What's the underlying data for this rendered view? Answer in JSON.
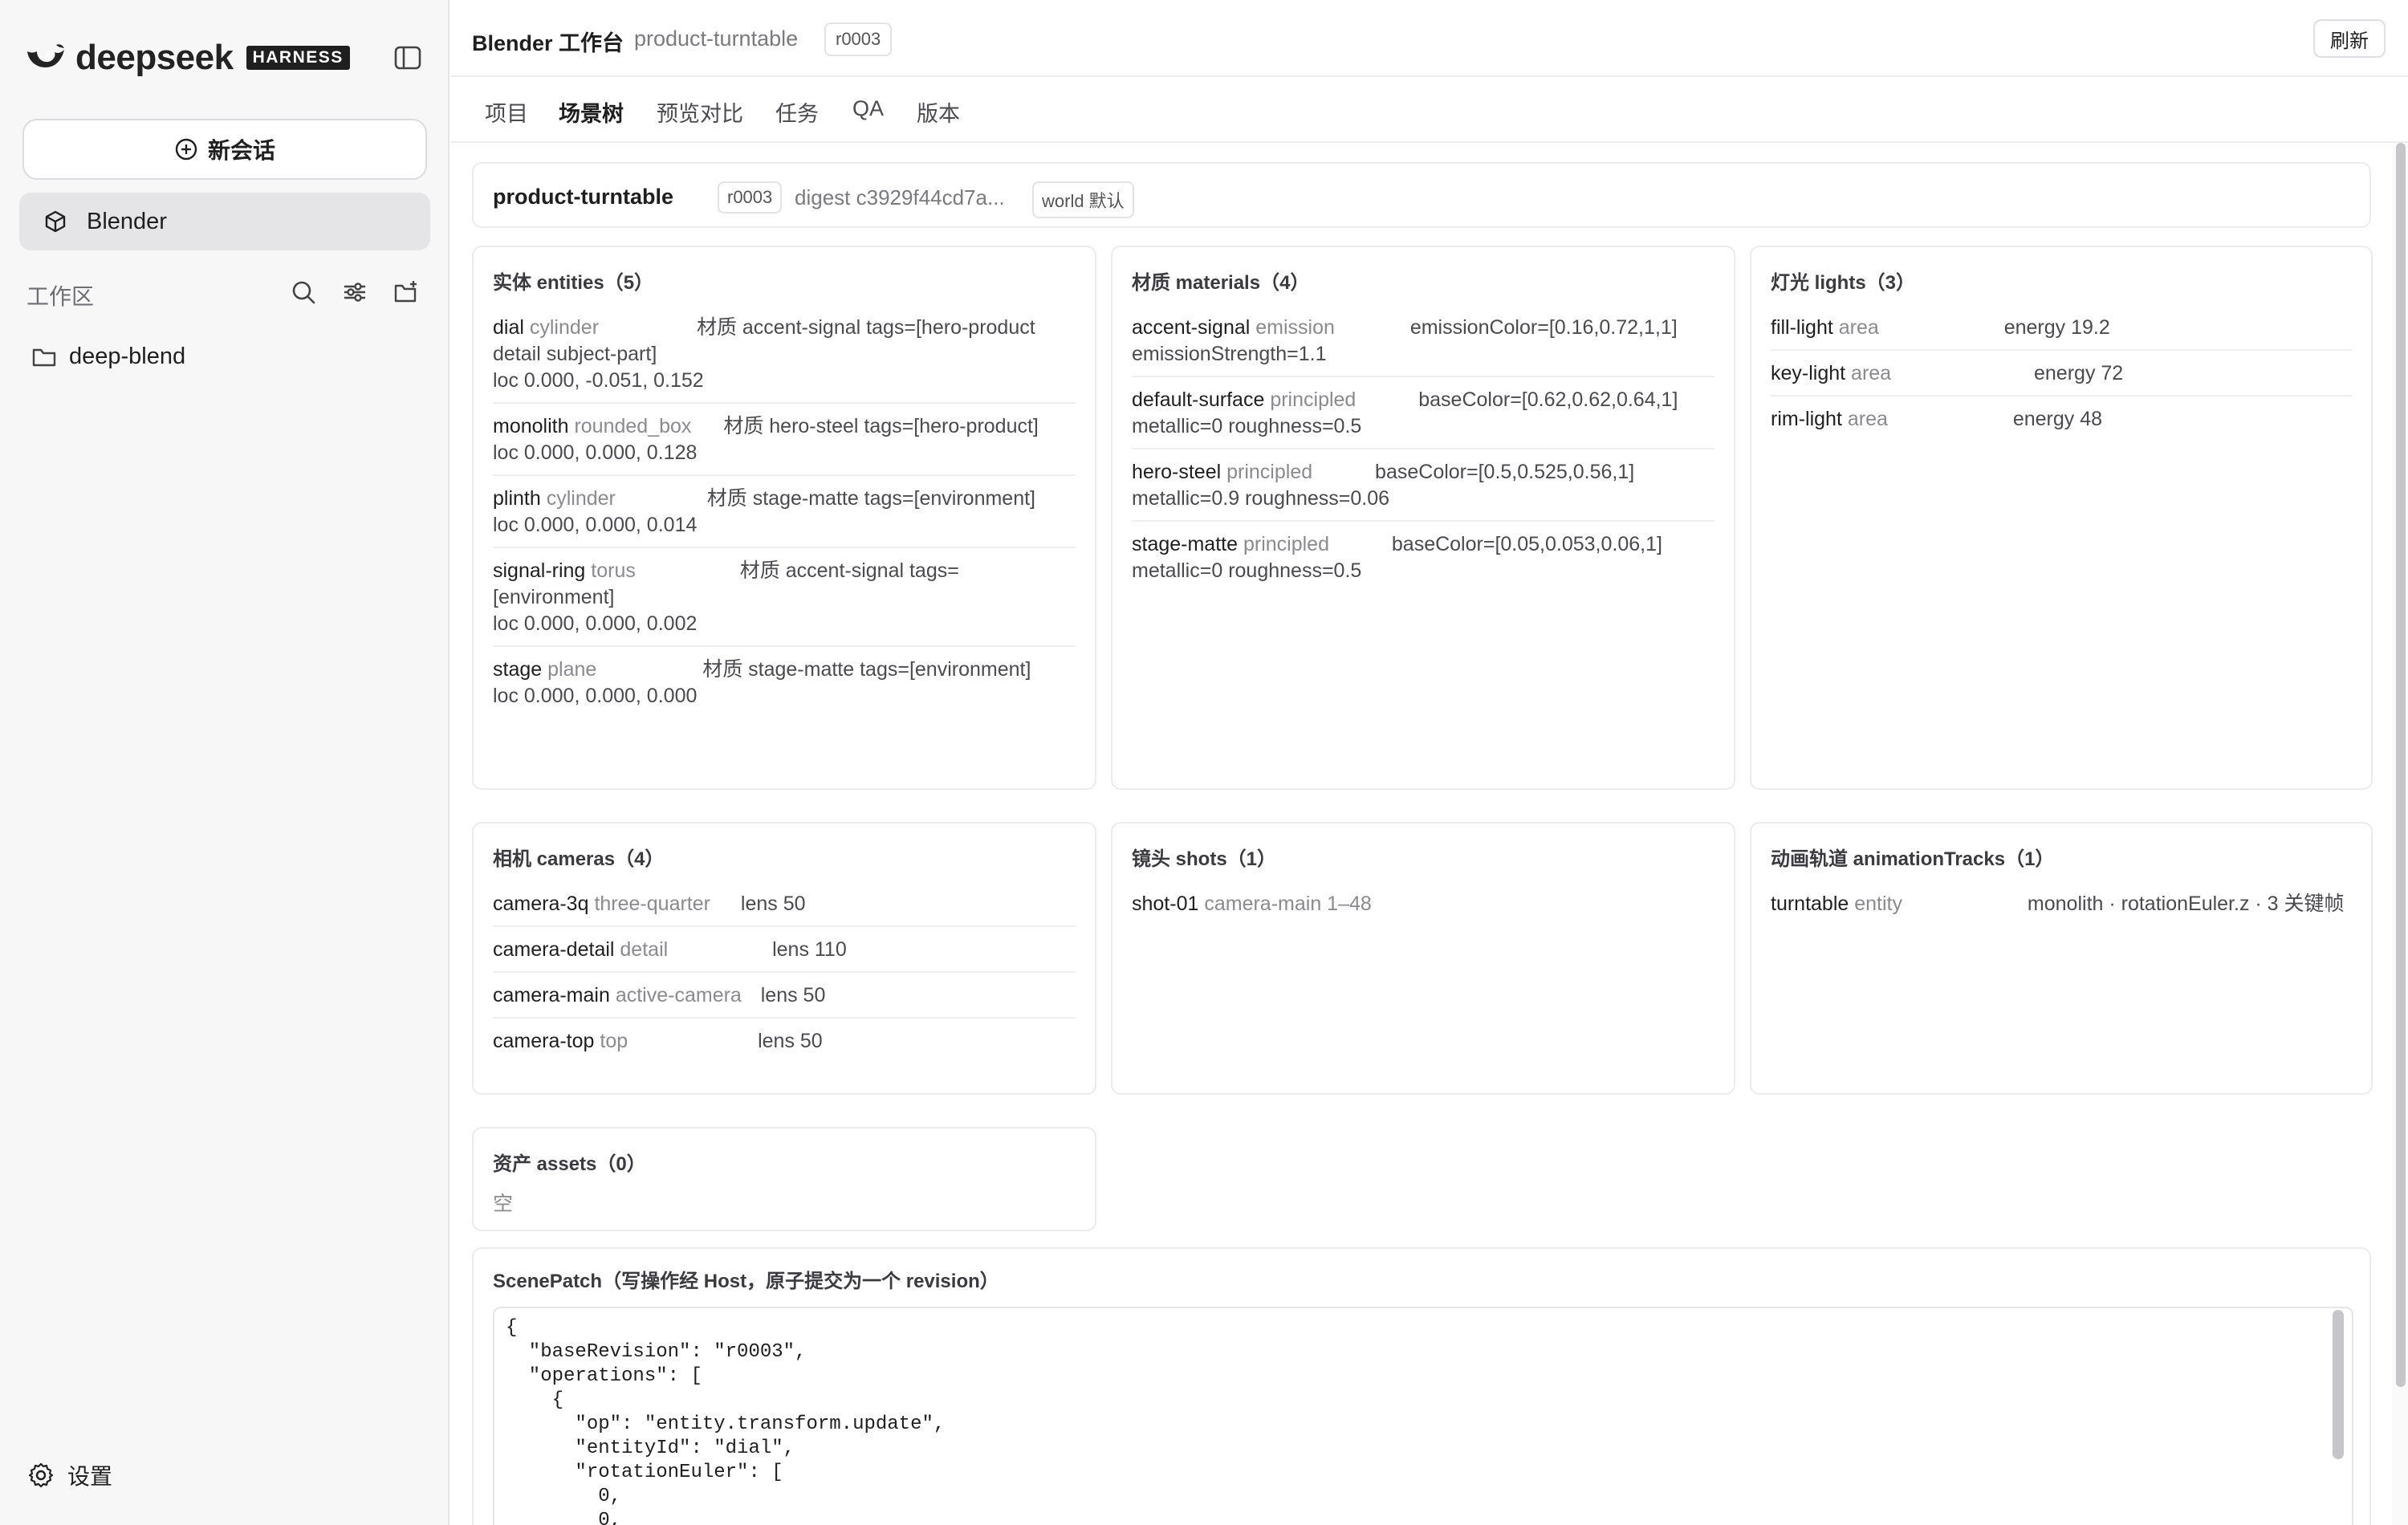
{
  "sidebar": {
    "brand": {
      "word": "deepseek",
      "badge": "HARNESS"
    },
    "new_chat_label": "新会话",
    "nav_item": "Blender",
    "workspace_label": "工作区",
    "folder": "deep-blend",
    "settings_label": "设置"
  },
  "topbar": {
    "title": "Blender 工作台",
    "project": "product-turntable",
    "revision": "r0003",
    "refresh_label": "刷新"
  },
  "tabs": [
    "项目",
    "场景树",
    "预览对比",
    "任务",
    "QA",
    "版本"
  ],
  "active_tab": "场景树",
  "scene_header": {
    "name": "product-turntable",
    "revision": "r0003",
    "digest": "digest c3929f44cd7a...",
    "world": "world 默认"
  },
  "entities": {
    "title": "实体 entities（5）",
    "items": [
      {
        "name": "dial",
        "type": "cylinder",
        "detail": "材质 accent-signal tags=[hero-product detail subject-part]",
        "loc": "loc 0.000, -0.051, 0.152"
      },
      {
        "name": "monolith",
        "type": "rounded_box",
        "detail": "材质 hero-steel tags=[hero-product]",
        "loc": "loc 0.000, 0.000, 0.128"
      },
      {
        "name": "plinth",
        "type": "cylinder",
        "detail": "材质 stage-matte tags=[environment]",
        "loc": "loc 0.000, 0.000, 0.014"
      },
      {
        "name": "signal-ring",
        "type": "torus",
        "detail": "材质 accent-signal tags=[environment]",
        "loc": "loc 0.000, 0.000, 0.002"
      },
      {
        "name": "stage",
        "type": "plane",
        "detail": "材质 stage-matte tags=[environment]",
        "loc": "loc 0.000, 0.000, 0.000"
      }
    ]
  },
  "materials": {
    "title": "材质 materials（4）",
    "items": [
      {
        "name": "accent-signal",
        "type": "emission",
        "detail": "emissionColor=[0.16,0.72,1,1] emissionStrength=1.1"
      },
      {
        "name": "default-surface",
        "type": "principled",
        "detail": "baseColor=[0.62,0.62,0.64,1] metallic=0 roughness=0.5"
      },
      {
        "name": "hero-steel",
        "type": "principled",
        "detail": "baseColor=[0.5,0.525,0.56,1] metallic=0.9 roughness=0.06"
      },
      {
        "name": "stage-matte",
        "type": "principled",
        "detail": "baseColor=[0.05,0.053,0.06,1] metallic=0 roughness=0.5"
      }
    ]
  },
  "lights": {
    "title": "灯光 lights（3）",
    "items": [
      {
        "name": "fill-light",
        "type": "area",
        "detail": "energy 19.2"
      },
      {
        "name": "key-light",
        "type": "area",
        "detail": "energy 72"
      },
      {
        "name": "rim-light",
        "type": "area",
        "detail": "energy 48"
      }
    ]
  },
  "cameras": {
    "title": "相机 cameras（4）",
    "items": [
      {
        "name": "camera-3q",
        "type": "three-quarter",
        "detail": "lens 50"
      },
      {
        "name": "camera-detail",
        "type": "detail",
        "detail": "lens 110"
      },
      {
        "name": "camera-main",
        "type": "active-camera",
        "detail": "lens 50"
      },
      {
        "name": "camera-top",
        "type": "top",
        "detail": "lens 50"
      }
    ]
  },
  "shots": {
    "title": "镜头 shots（1）",
    "items": [
      {
        "name": "shot-01",
        "type": "camera-main 1–48",
        "detail": ""
      }
    ]
  },
  "animation_tracks": {
    "title": "动画轨道 animationTracks（1）",
    "items": [
      {
        "name": "turntable",
        "type": "entity",
        "detail": "monolith · rotationEuler.z · 3 关键帧"
      }
    ]
  },
  "assets": {
    "title": "资产 assets（0）",
    "empty": "空"
  },
  "scene_patch": {
    "title": "ScenePatch（写操作经 Host，原子提交为一个 revision）",
    "code": "{\n  \"baseRevision\": \"r0003\",\n  \"operations\": [\n    {\n      \"op\": \"entity.transform.update\",\n      \"entityId\": \"dial\",\n      \"rotationEuler\": [\n        0,\n        0,"
  }
}
